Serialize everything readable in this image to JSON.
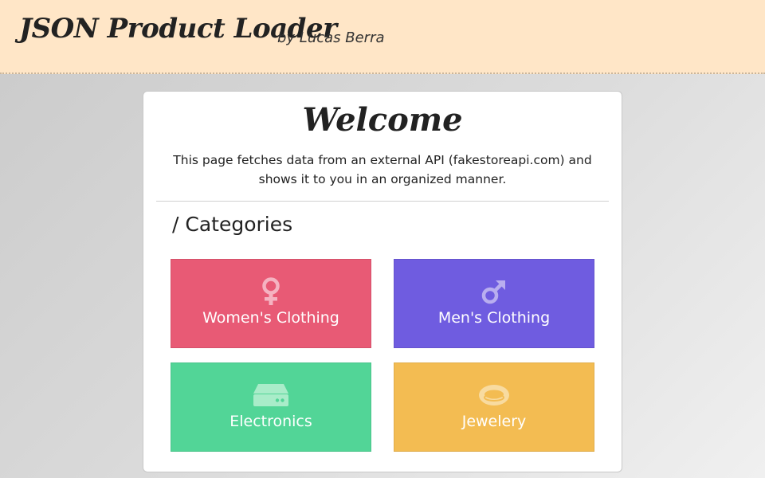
{
  "header": {
    "title": "JSON Product Loader",
    "author": "by Lucas Berra",
    "background_color": "#ffe6c7"
  },
  "welcome": {
    "title": "Welcome",
    "description": "This page fetches data from an external API (fakestoreapi.com) and shows it to you in an organized manner."
  },
  "categories": {
    "heading": "/ Categories",
    "items": [
      {
        "label": "Women's Clothing",
        "icon": "female-icon",
        "color": "#e85a75"
      },
      {
        "label": "Men's Clothing",
        "icon": "male-icon",
        "color": "#6f5ce0"
      },
      {
        "label": "Electronics",
        "icon": "hard-drive-icon",
        "color": "#52d597"
      },
      {
        "label": "Jewelery",
        "icon": "ring-icon",
        "color": "#f3bc52"
      }
    ]
  }
}
